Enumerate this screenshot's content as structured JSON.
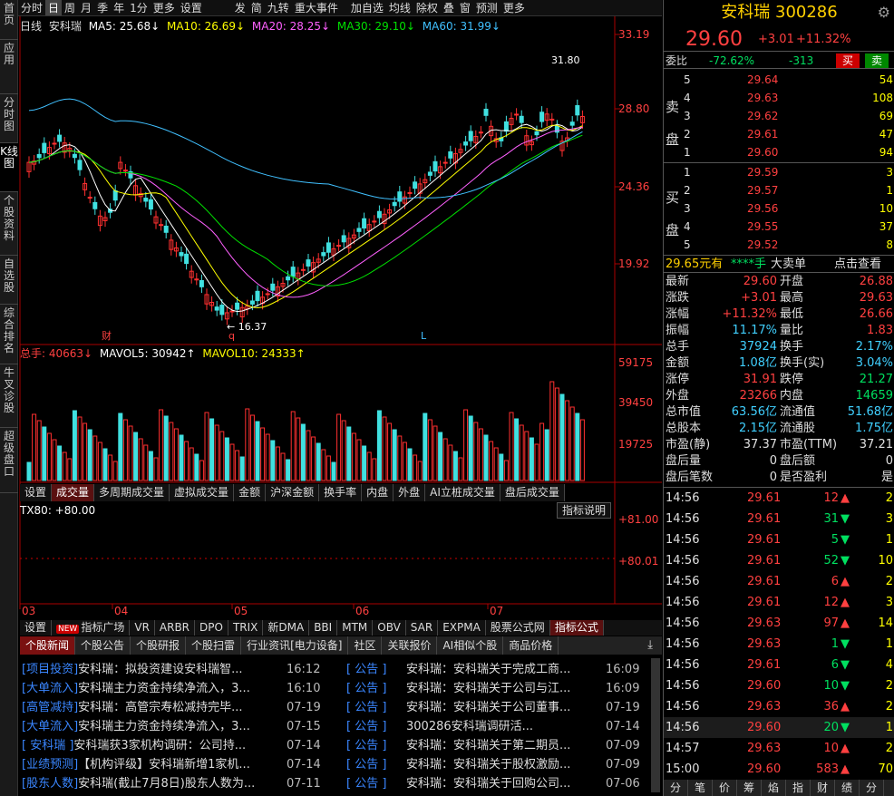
{
  "left_tabs": [
    "首页",
    "应用",
    "分时图",
    "K线图",
    "个股资料",
    "自选股",
    "综合排名",
    "牛叉诊股",
    "超级盘口"
  ],
  "top_toolbar": [
    "分时",
    "日",
    "周",
    "月",
    "季",
    "年",
    "1分",
    "更多",
    "设置",
    "发",
    "简",
    "九转",
    "重大事件",
    "加自选",
    "均线",
    "除权",
    "叠",
    "窗",
    "预测",
    "更多"
  ],
  "chart_header": {
    "period": "日线",
    "stock": "安科瑞",
    "ma5": "MA5: 25.68↓",
    "ma10": "MA10: 26.69↓",
    "ma20": "MA20: 28.25↓",
    "ma30": "MA30: 29.10↓",
    "ma60": "MA60: 31.99↓"
  },
  "price_axis": [
    "33.19",
    "28.80",
    "24.36",
    "19.92"
  ],
  "annotations": {
    "high": "31.80",
    "low": "16.37",
    "cai": "财",
    "q": "q",
    "l": "L"
  },
  "volume_header": {
    "total": "总手: 40663↓",
    "mavol5": "MAVOL5: 30942↑",
    "mavol10": "MAVOL10: 24333↑"
  },
  "volume_axis": [
    "59175",
    "39450",
    "19725"
  ],
  "sub_tabs": [
    "设置",
    "成交量",
    "多周期成交量",
    "虚拟成交量",
    "金额",
    "沪深金额",
    "换手率",
    "内盘",
    "外盘",
    "AI立桩成交量",
    "盘后成交量"
  ],
  "indicator": {
    "label": "TX80: +80.00",
    "explain": "指标说明",
    "axis_top": "+81.00",
    "axis_mid": "+80.01"
  },
  "months": [
    "03",
    "04",
    "05",
    "06",
    "07"
  ],
  "bottom_tabs": [
    "设置",
    "指标广场",
    "VR",
    "ARBR",
    "DPO",
    "TRIX",
    "新DMA",
    "BBI",
    "MTM",
    "OBV",
    "SAR",
    "EXPMA",
    "股票公式网",
    "指标公式"
  ],
  "new_badge": "NEW",
  "news_tabs": [
    "个股新闻",
    "个股公告",
    "个股研报",
    "个股扫雷",
    "行业资讯[电力设备]",
    "社区",
    "关联报价",
    "AI相似个股",
    "商品价格"
  ],
  "news_left": [
    {
      "tag": "[项目投资]",
      "text": "安科瑞：拟投资建设安科瑞智...",
      "date": "16:12"
    },
    {
      "tag": "[大单流入]",
      "text": "安科瑞主力资金持续净流入，3...",
      "date": "16:10"
    },
    {
      "tag": "[高管减持]",
      "text": "安科瑞：高管宗寿松减持完毕...",
      "date": "07-19"
    },
    {
      "tag": "[大单流入]",
      "text": "安科瑞主力资金持续净流入，3...",
      "date": "07-15"
    },
    {
      "tag": "[ 安科瑞 ]",
      "text": "安科瑞获3家机构调研：公司持...",
      "date": "07-14"
    },
    {
      "tag": "[业绩预测]",
      "text": "【机构评级】安科瑞新增1家机...",
      "date": "07-14"
    },
    {
      "tag": "[股东人数]",
      "text": "安科瑞(截止7月8日)股东人数为...",
      "date": "07-11"
    }
  ],
  "news_right": [
    {
      "tag": "[ 公告 ]",
      "text": "安科瑞：安科瑞关于完成工商...",
      "date": "16:09"
    },
    {
      "tag": "[ 公告 ]",
      "text": "安科瑞：安科瑞关于公司与江...",
      "date": "16:09"
    },
    {
      "tag": "[ 公告 ]",
      "text": "安科瑞：安科瑞关于公司董事...",
      "date": "07-19"
    },
    {
      "tag": "[ 公告 ]",
      "text": "300286安科瑞调研活...",
      "date": "07-14"
    },
    {
      "tag": "[ 公告 ]",
      "text": "安科瑞：安科瑞关于第二期员...",
      "date": "07-09"
    },
    {
      "tag": "[ 公告 ]",
      "text": "安科瑞：安科瑞关于股权激励...",
      "date": "07-09"
    },
    {
      "tag": "[ 公告 ]",
      "text": "安科瑞：安科瑞关于回购公司...",
      "date": "07-06"
    }
  ],
  "quote": {
    "name": "安科瑞",
    "code": "300286",
    "price": "29.60",
    "change": "+3.01",
    "pct": "+11.32%",
    "weibi_label": "委比",
    "weibi": "-72.62%",
    "weicha": "-313",
    "buy_btn": "买",
    "sell_btn": "卖",
    "sell_label": [
      "卖",
      "盘"
    ],
    "buy_label": [
      "买",
      "盘"
    ],
    "asks": [
      {
        "lv": "5",
        "p": "29.64",
        "v": "54"
      },
      {
        "lv": "4",
        "p": "29.63",
        "v": "108"
      },
      {
        "lv": "3",
        "p": "29.62",
        "v": "69"
      },
      {
        "lv": "2",
        "p": "29.61",
        "v": "47"
      },
      {
        "lv": "1",
        "p": "29.60",
        "v": "94"
      }
    ],
    "bids": [
      {
        "lv": "1",
        "p": "29.59",
        "v": "3"
      },
      {
        "lv": "2",
        "p": "29.57",
        "v": "1"
      },
      {
        "lv": "3",
        "p": "29.56",
        "v": "10"
      },
      {
        "lv": "4",
        "p": "29.55",
        "v": "37"
      },
      {
        "lv": "5",
        "p": "29.52",
        "v": "8"
      }
    ],
    "bigorder": {
      "price": "29.65元有",
      "stars": "****手",
      "label": "大卖单",
      "link": "点击查看"
    },
    "stats": [
      [
        "最新",
        "29.60",
        "开盘",
        "26.88"
      ],
      [
        "涨跌",
        "+3.01",
        "最高",
        "29.63"
      ],
      [
        "涨幅",
        "+11.32%",
        "最低",
        "26.66"
      ],
      [
        "振幅",
        "11.17%",
        "量比",
        "1.83"
      ],
      [
        "总手",
        "37924",
        "换手",
        "2.17%"
      ],
      [
        "金额",
        "1.08亿",
        "换手(实)",
        "3.04%"
      ],
      [
        "涨停",
        "31.91",
        "跌停",
        "21.27"
      ],
      [
        "外盘",
        "23266",
        "内盘",
        "14659"
      ],
      [
        "总市值",
        "63.56亿",
        "流通值",
        "51.68亿"
      ],
      [
        "总股本",
        "2.15亿",
        "流通股",
        "1.75亿"
      ],
      [
        "市盈(静)",
        "37.37",
        "市盈(TTM)",
        "37.21"
      ],
      [
        "盘后量",
        "0",
        "盘后额",
        "0"
      ],
      [
        "盘后笔数",
        "0",
        "是否盈利",
        "是"
      ]
    ],
    "ticks": [
      {
        "t": "14:56",
        "p": "29.61",
        "v": "12",
        "d": "up",
        "n": "2"
      },
      {
        "t": "14:56",
        "p": "29.61",
        "v": "31",
        "d": "down",
        "n": "3"
      },
      {
        "t": "14:56",
        "p": "29.61",
        "v": "5",
        "d": "down",
        "n": "1"
      },
      {
        "t": "14:56",
        "p": "29.61",
        "v": "52",
        "d": "down",
        "n": "10"
      },
      {
        "t": "14:56",
        "p": "29.61",
        "v": "6",
        "d": "up",
        "n": "2"
      },
      {
        "t": "14:56",
        "p": "29.61",
        "v": "12",
        "d": "up",
        "n": "3"
      },
      {
        "t": "14:56",
        "p": "29.63",
        "v": "97",
        "d": "up",
        "n": "14"
      },
      {
        "t": "14:56",
        "p": "29.63",
        "v": "1",
        "d": "down",
        "n": "1"
      },
      {
        "t": "14:56",
        "p": "29.61",
        "v": "6",
        "d": "down",
        "n": "4"
      },
      {
        "t": "14:56",
        "p": "29.60",
        "v": "10",
        "d": "down",
        "n": "2"
      },
      {
        "t": "14:56",
        "p": "29.63",
        "v": "36",
        "d": "up",
        "n": "2"
      },
      {
        "t": "14:56",
        "p": "29.60",
        "v": "20",
        "d": "down",
        "n": "1"
      },
      {
        "t": "14:57",
        "p": "29.63",
        "v": "10",
        "d": "up",
        "n": "2"
      },
      {
        "t": "15:00",
        "p": "29.60",
        "v": "583",
        "d": "up",
        "n": "70"
      }
    ],
    "bottom_tabs": [
      "分",
      "笔",
      "价",
      "筹",
      "焰",
      "指",
      "财",
      "绩",
      "分"
    ]
  }
}
